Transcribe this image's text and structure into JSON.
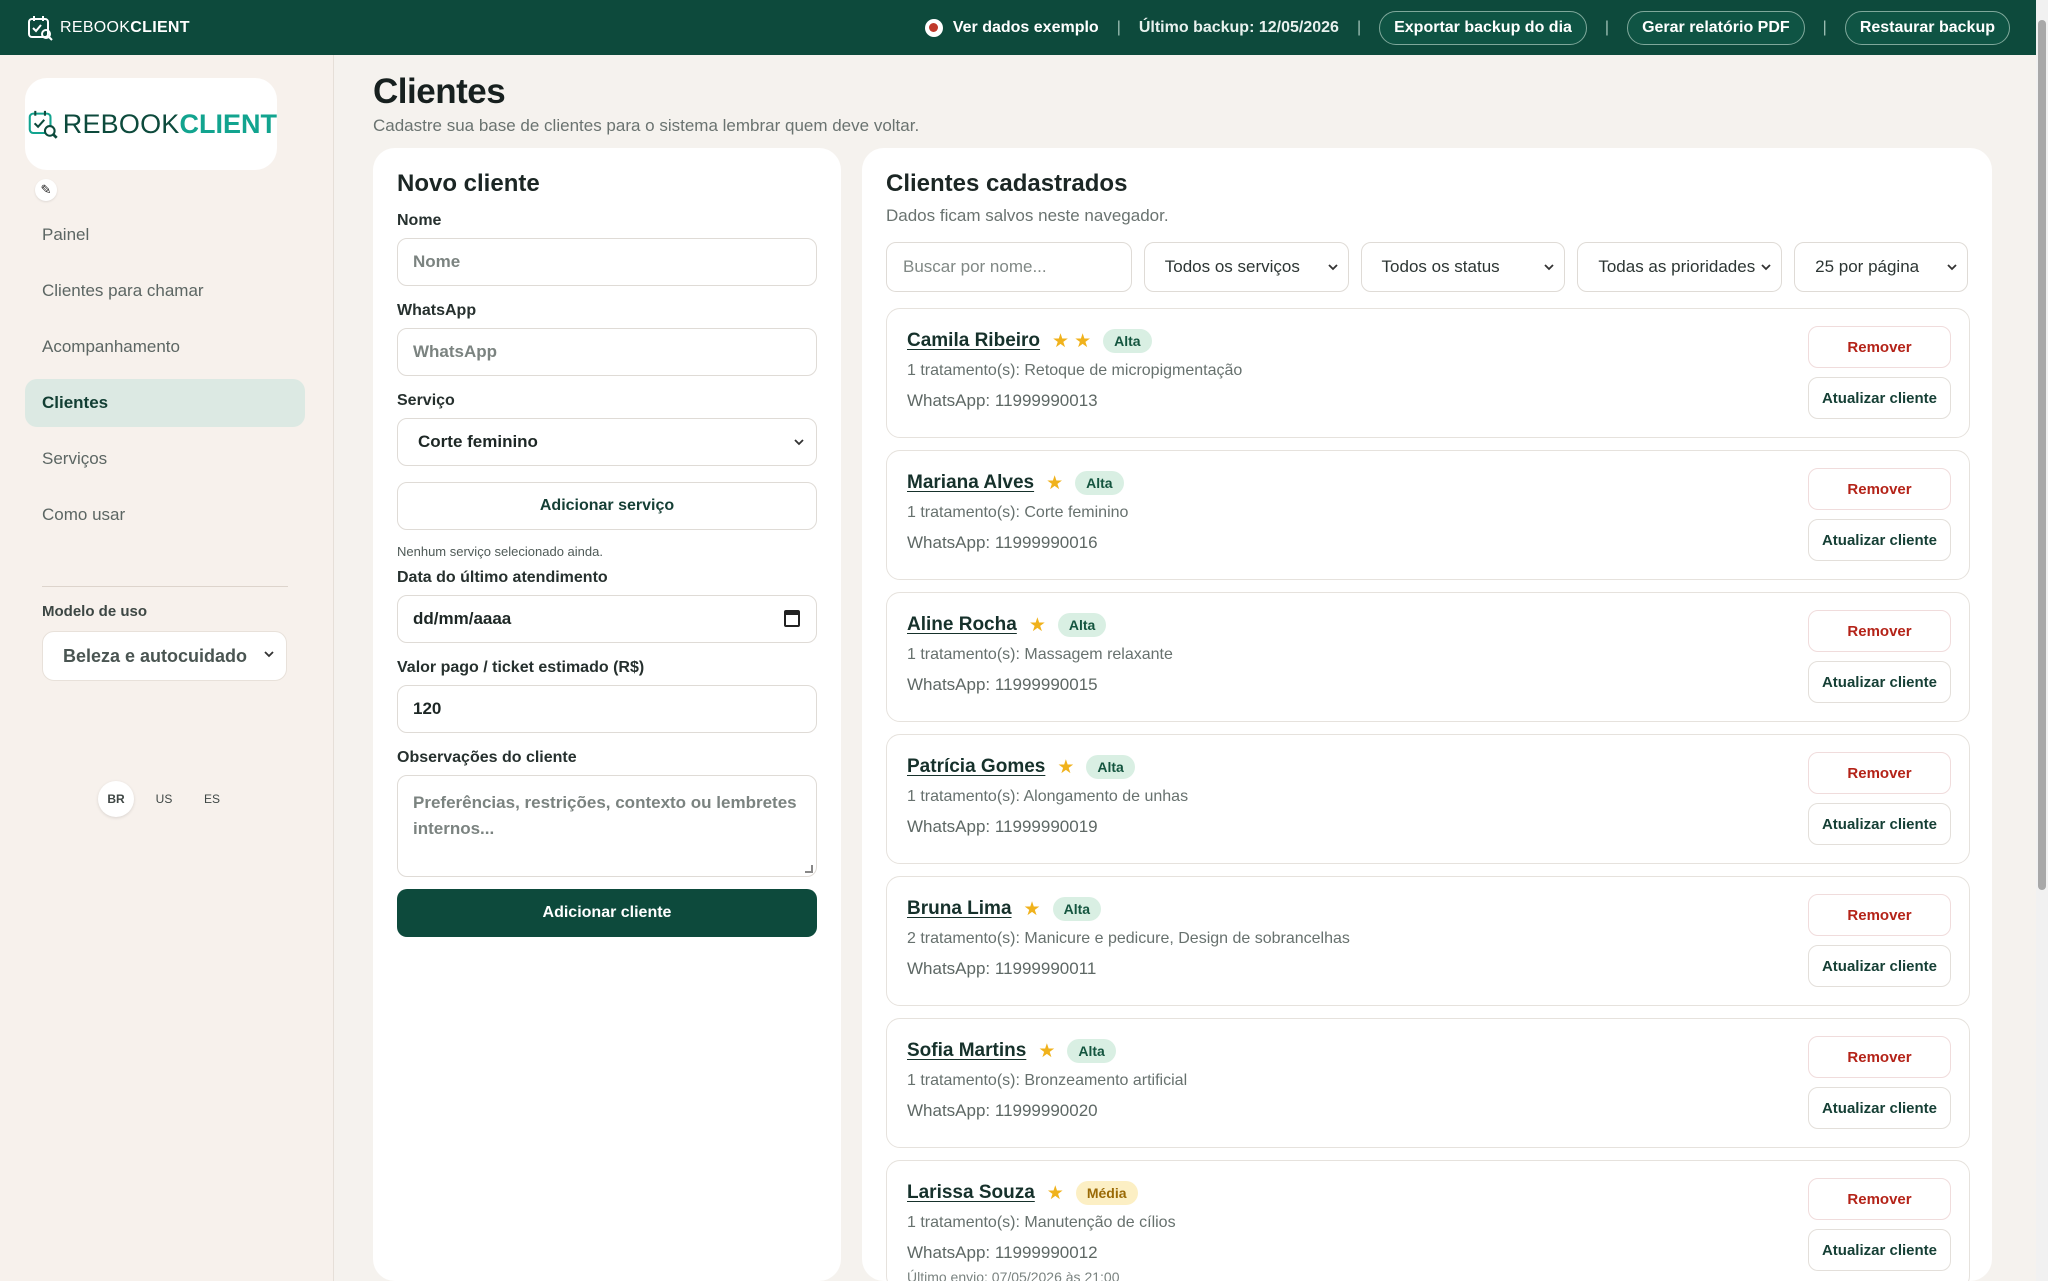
{
  "topbar": {
    "brand_light": "REBOOK",
    "brand_bold": "CLIENT",
    "demo_label": "Ver dados exemplo",
    "backup_text": "Último backup: 12/05/2026",
    "export_btn": "Exportar backup do dia",
    "pdf_btn": "Gerar relatório PDF",
    "restore_btn": "Restaurar backup",
    "sep": "|"
  },
  "sidebar": {
    "logo_light": "REBOOK",
    "logo_bold": "CLIENT",
    "edit_icon": "✎",
    "nav": [
      {
        "label": "Painel"
      },
      {
        "label": "Clientes para chamar"
      },
      {
        "label": "Acompanhamento"
      },
      {
        "label": "Clientes"
      },
      {
        "label": "Serviços"
      },
      {
        "label": "Como usar"
      }
    ],
    "active_index": 3,
    "model_label": "Modelo de uso",
    "model_value": "Beleza e autocuidado",
    "languages": [
      "BR",
      "US",
      "ES"
    ]
  },
  "page": {
    "title": "Clientes",
    "subtitle": "Cadastre sua base de clientes para o sistema lembrar quem deve voltar."
  },
  "form": {
    "title": "Novo cliente",
    "name_label": "Nome",
    "name_placeholder": "Nome",
    "whatsapp_label": "WhatsApp",
    "whatsapp_placeholder": "WhatsApp",
    "service_label": "Serviço",
    "service_value": "Corte feminino",
    "add_service_btn": "Adicionar serviço",
    "no_service_hint": "Nenhum serviço selecionado ainda.",
    "date_label": "Data do último atendimento",
    "date_placeholder": "dd/mm/aaaa",
    "value_label": "Valor pago / ticket estimado (R$)",
    "value_value": "120",
    "notes_label": "Observações do cliente",
    "notes_placeholder": "Preferências, restrições, contexto ou lembretes internos...",
    "submit_btn": "Adicionar cliente"
  },
  "list": {
    "title": "Clientes cadastrados",
    "subtitle": "Dados ficam salvos neste navegador.",
    "search_placeholder": "Buscar por nome...",
    "filter_services": "Todos os serviços",
    "filter_status": "Todos os status",
    "filter_priority": "Todas as prioridades",
    "per_page": "25 por página",
    "remove_label": "Remover",
    "update_label": "Atualizar cliente",
    "clients": [
      {
        "name": "Camila Ribeiro",
        "stars": 2,
        "priority": "Alta",
        "treatments": "1 tratamento(s): Retoque de micropigmentação",
        "whatsapp": "WhatsApp: 11999990013",
        "extra": ""
      },
      {
        "name": "Mariana Alves",
        "stars": 1,
        "priority": "Alta",
        "treatments": "1 tratamento(s): Corte feminino",
        "whatsapp": "WhatsApp: 11999990016",
        "extra": ""
      },
      {
        "name": "Aline Rocha",
        "stars": 1,
        "priority": "Alta",
        "treatments": "1 tratamento(s): Massagem relaxante",
        "whatsapp": "WhatsApp: 11999990015",
        "extra": ""
      },
      {
        "name": "Patrícia Gomes",
        "stars": 1,
        "priority": "Alta",
        "treatments": "1 tratamento(s): Alongamento de unhas",
        "whatsapp": "WhatsApp: 11999990019",
        "extra": ""
      },
      {
        "name": "Bruna Lima",
        "stars": 1,
        "priority": "Alta",
        "treatments": "2 tratamento(s): Manicure e pedicure, Design de sobrancelhas",
        "whatsapp": "WhatsApp: 11999990011",
        "extra": ""
      },
      {
        "name": "Sofia Martins",
        "stars": 1,
        "priority": "Alta",
        "treatments": "1 tratamento(s): Bronzeamento artificial",
        "whatsapp": "WhatsApp: 11999990020",
        "extra": ""
      },
      {
        "name": "Larissa Souza",
        "stars": 1,
        "priority": "Média",
        "treatments": "1 tratamento(s): Manutenção de cílios",
        "whatsapp": "WhatsApp: 11999990012",
        "extra": "Último envio: 07/05/2026 às 21:00"
      }
    ]
  }
}
